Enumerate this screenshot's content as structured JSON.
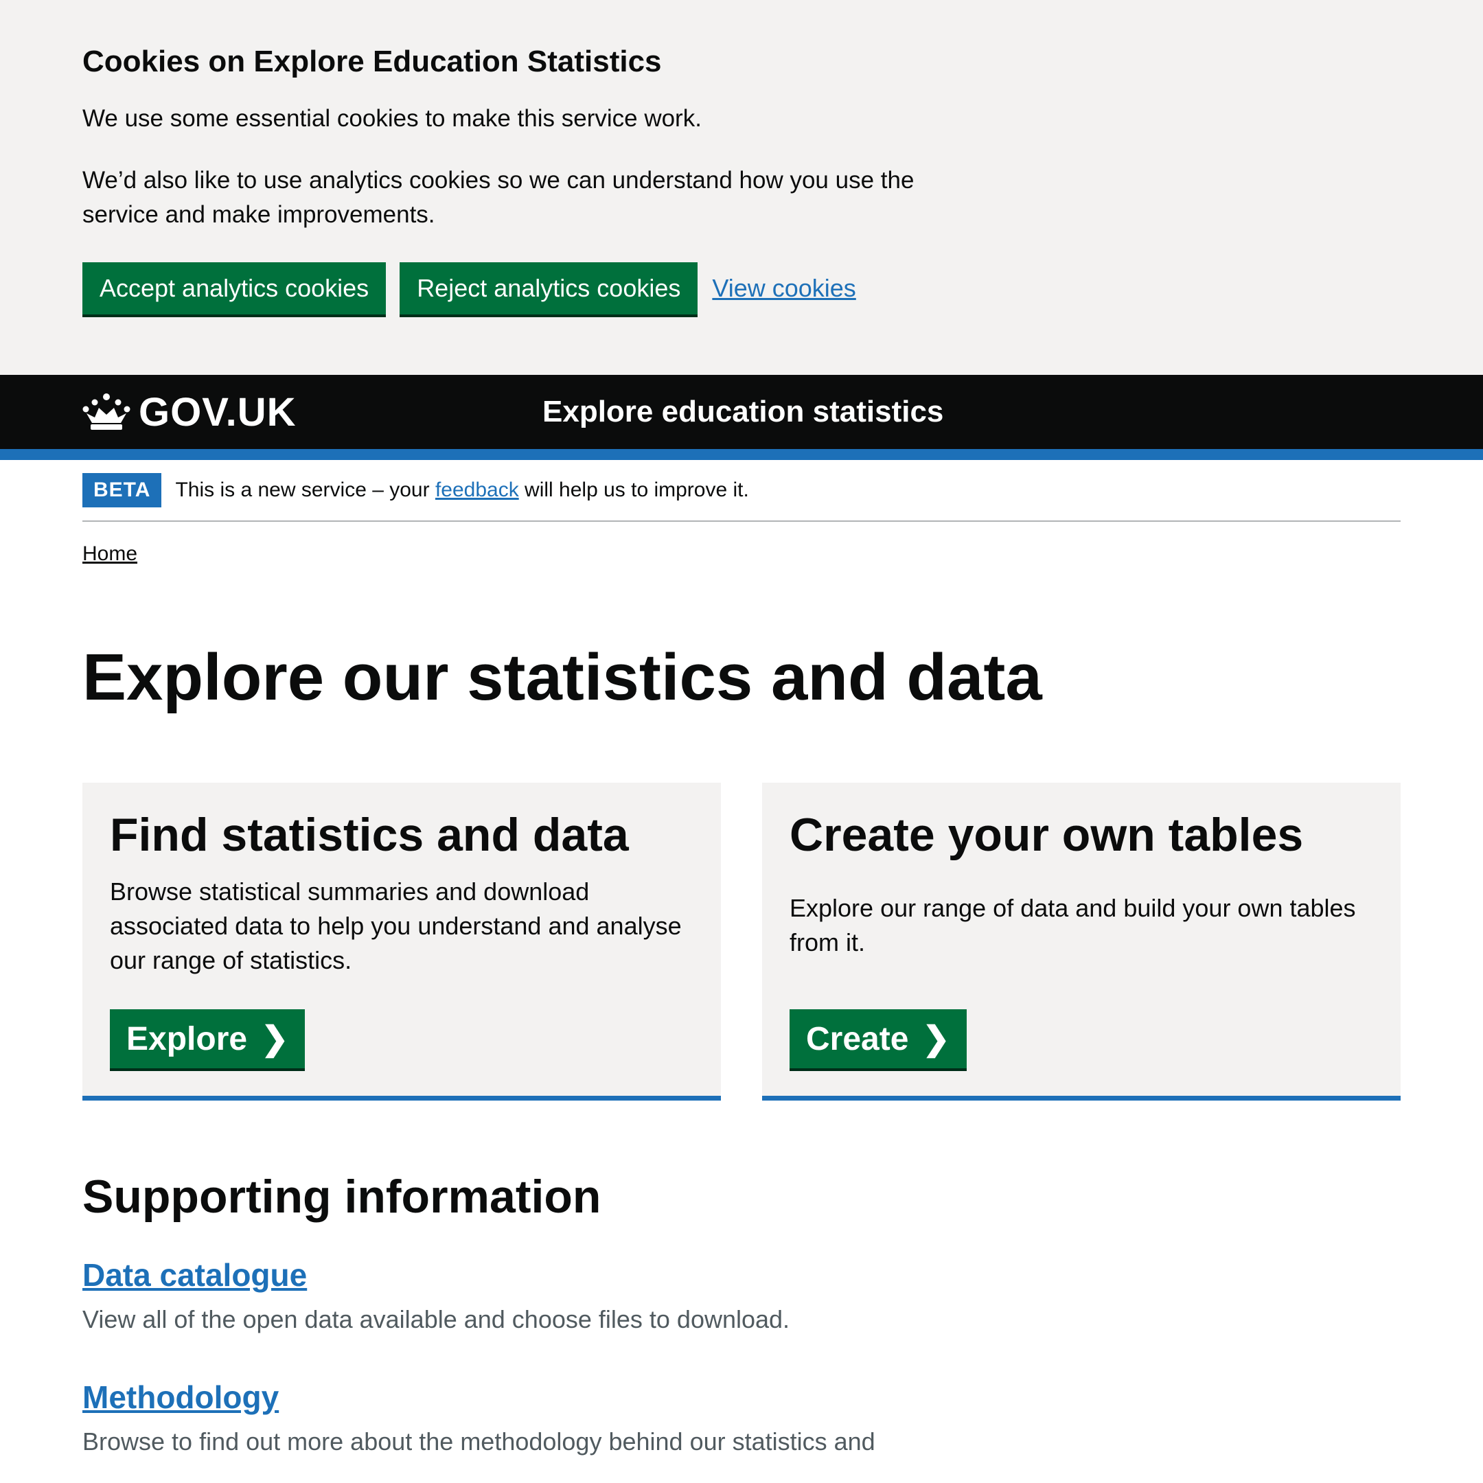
{
  "cookie_banner": {
    "title": "Cookies on Explore Education Statistics",
    "paragraph1": "We use some essential cookies to make this service work.",
    "paragraph2": "We’d also like to use analytics cookies so we can understand how you use the service and make improvements.",
    "accept_label": "Accept analytics cookies",
    "reject_label": "Reject analytics cookies",
    "view_label": "View cookies"
  },
  "header": {
    "logo_text": "GOV.UK",
    "service_name": "Explore education statistics",
    "crown_icon": "crown-icon"
  },
  "phase_banner": {
    "tag": "BETA",
    "text_before": "This is a new service – your ",
    "link_text": "feedback",
    "text_after": " will help us to improve it."
  },
  "breadcrumb": {
    "home": "Home"
  },
  "page_title": "Explore our statistics and data",
  "cards": [
    {
      "title": "Find statistics and data",
      "description": "Browse statistical summaries and download associated data to help you understand and analyse our range of statistics.",
      "button_label": "Explore",
      "button_icon": "chevron-right-icon"
    },
    {
      "title": "Create your own tables",
      "description": "Explore our range of data and build your own tables from it.",
      "button_label": "Create",
      "button_icon": "chevron-right-icon"
    }
  ],
  "supporting": {
    "heading": "Supporting information",
    "items": [
      {
        "title": "Data catalogue",
        "description": "View all of the open data available and choose files to download."
      },
      {
        "title": "Methodology",
        "description": "Browse to find out more about the methodology behind our statistics and"
      }
    ]
  },
  "colors": {
    "brand_green": "#00703c",
    "link_blue": "#1d70b8",
    "header_black": "#0b0c0c",
    "panel_grey": "#f3f2f1"
  }
}
